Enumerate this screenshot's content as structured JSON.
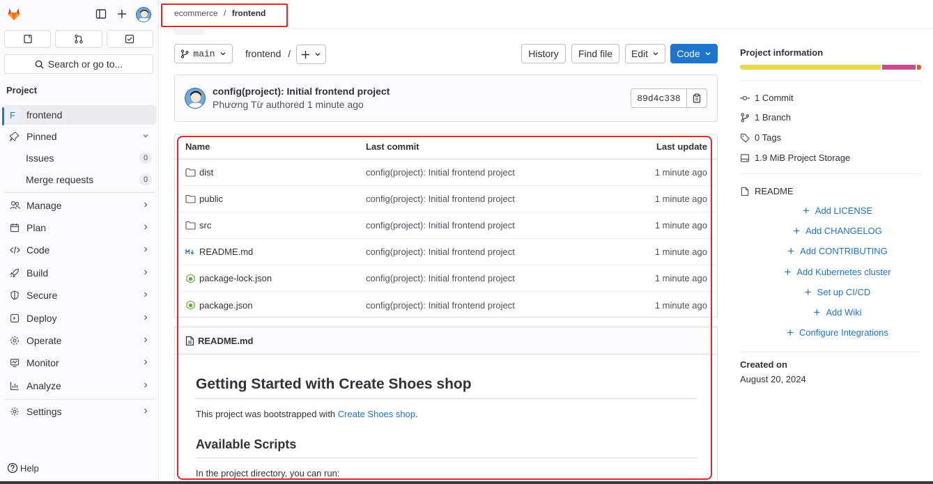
{
  "sidebar": {
    "search_placeholder": "Search or go to...",
    "section_title": "Project",
    "project": {
      "initial": "F",
      "name": "frontend"
    },
    "pinned": "Pinned",
    "issues": {
      "label": "Issues",
      "count": "0"
    },
    "merge_requests": {
      "label": "Merge requests",
      "count": "0"
    },
    "items": [
      "Manage",
      "Plan",
      "Code",
      "Build",
      "Secure",
      "Deploy",
      "Operate",
      "Monitor",
      "Analyze"
    ],
    "settings": "Settings",
    "help": "Help"
  },
  "breadcrumb": {
    "group": "ecommerce",
    "separator": "/",
    "project": "frontend"
  },
  "toolbar": {
    "branch": "main",
    "path": "frontend",
    "path_sep": "/",
    "history": "History",
    "find_file": "Find file",
    "edit": "Edit",
    "code": "Code"
  },
  "commit": {
    "title": "config(project): Initial frontend project",
    "author": "Phương Từ",
    "authored": "authored",
    "time": "1 minute ago",
    "sha": "89d4c338"
  },
  "files": {
    "headers": {
      "name": "Name",
      "last_commit": "Last commit",
      "last_update": "Last update"
    },
    "rows": [
      {
        "name": "dist",
        "type": "folder",
        "commit": "config(project): Initial frontend project",
        "updated": "1 minute ago"
      },
      {
        "name": "public",
        "type": "folder",
        "commit": "config(project): Initial frontend project",
        "updated": "1 minute ago"
      },
      {
        "name": "src",
        "type": "folder",
        "commit": "config(project): Initial frontend project",
        "updated": "1 minute ago"
      },
      {
        "name": "README.md",
        "type": "markdown",
        "commit": "config(project): Initial frontend project",
        "updated": "1 minute ago"
      },
      {
        "name": "package-lock.json",
        "type": "node",
        "commit": "config(project): Initial frontend project",
        "updated": "1 minute ago"
      },
      {
        "name": "package.json",
        "type": "node",
        "commit": "config(project): Initial frontend project",
        "updated": "1 minute ago"
      }
    ]
  },
  "readme": {
    "filename": "README.md",
    "h1": "Getting Started with Create Shoes shop",
    "p1_prefix": "This project was bootstrapped with ",
    "p1_link": "Create Shoes shop",
    "p1_suffix": ".",
    "h2": "Available Scripts",
    "p2": "In the project directory, you can run:"
  },
  "info": {
    "title": "Project information",
    "commits": "1 Commit",
    "branches": "1 Branch",
    "tags": "0 Tags",
    "storage": "1.9 MiB Project Storage",
    "readme": "README",
    "links": [
      "Add LICENSE",
      "Add CHANGELOG",
      "Add CONTRIBUTING",
      "Add Kubernetes cluster",
      "Set up CI/CD",
      "Add Wiki",
      "Configure Integrations"
    ],
    "created_label": "Created on",
    "created_date": "August 20, 2024"
  },
  "colors": {
    "accent": "#1f75cb",
    "highlight_box": "#dd2b2b",
    "lang_yellow": "#e8d84e",
    "lang_pink": "#c94d8a",
    "lang_orange": "#e2592b"
  }
}
